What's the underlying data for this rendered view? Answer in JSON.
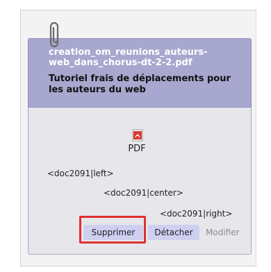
{
  "attachment": {
    "filename": "creation_om_reunions_auteurs-web_dans_chorus-dt-2-2.pdf",
    "title": "Tutoriel frais de déplacements pour les auteurs du web",
    "type_label": "PDF",
    "models": {
      "left": "<doc2091|left>",
      "center": "<doc2091|center>",
      "right": "<doc2091|right>"
    },
    "actions": {
      "delete": "Supprimer",
      "detach": "Détacher",
      "modify": "Modifier"
    }
  },
  "icons": {
    "clip": "paperclip-icon",
    "file": "pdf-file-icon"
  },
  "colors": {
    "header_bg": "#a8a7cf",
    "button_bg": "#cfd0f0",
    "highlight": "#e03030"
  }
}
